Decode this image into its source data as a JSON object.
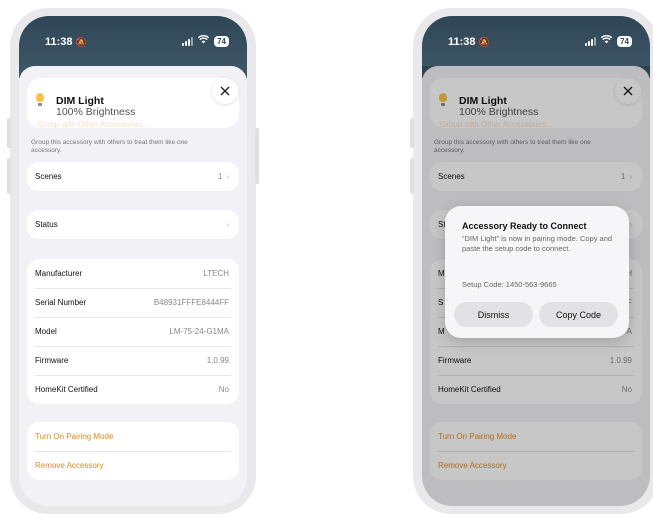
{
  "status": {
    "time": "11:38",
    "battery": "74"
  },
  "accessory": {
    "name": "DIM Light",
    "subtitle": "100% Brightness",
    "ghost_text": "Group with Other Accessories..."
  },
  "group_note": "Group this accessory with others to treat them like one accessory.",
  "scenes": {
    "label": "Scenes",
    "value": "1"
  },
  "status_row": {
    "label": "Status"
  },
  "info": [
    {
      "label": "Manufacturer",
      "value": "LTECH"
    },
    {
      "label": "Serial Number",
      "value": "B48931FFFE8444FF"
    },
    {
      "label": "Model",
      "value": "LM-75-24-G1MA"
    },
    {
      "label": "Firmware",
      "value": "1.0.99"
    },
    {
      "label": "HomeKit Certified",
      "value": "No"
    }
  ],
  "actions": {
    "pairing": "Turn On Pairing Mode",
    "remove": "Remove Accessory"
  },
  "alert": {
    "title": "Accessory Ready to Connect",
    "message": "“DIM Light” is now in pairing mode. Copy and paste the setup code to connect.",
    "setup_code": "Setup Code: 1450-563-9665",
    "dismiss": "Dismiss",
    "copy": "Copy Code"
  },
  "right_partial": {
    "status_prefix": "St",
    "man_prefix": "M",
    "serial_prefix": "S",
    "model_prefix": "M",
    "man_suffix": "H",
    "serial_suffix": "F",
    "model_suffix": "A"
  },
  "icons": {
    "close": "close-icon",
    "bulb": "lightbulb-icon",
    "chevron": "chevron-right-icon",
    "wifi": "wifi-icon",
    "signal": "signal-icon",
    "bell": "bell-slash-icon"
  },
  "colors": {
    "accent": "#e68a1e",
    "header": "#2f4656",
    "bulb": "#f6c34a"
  }
}
